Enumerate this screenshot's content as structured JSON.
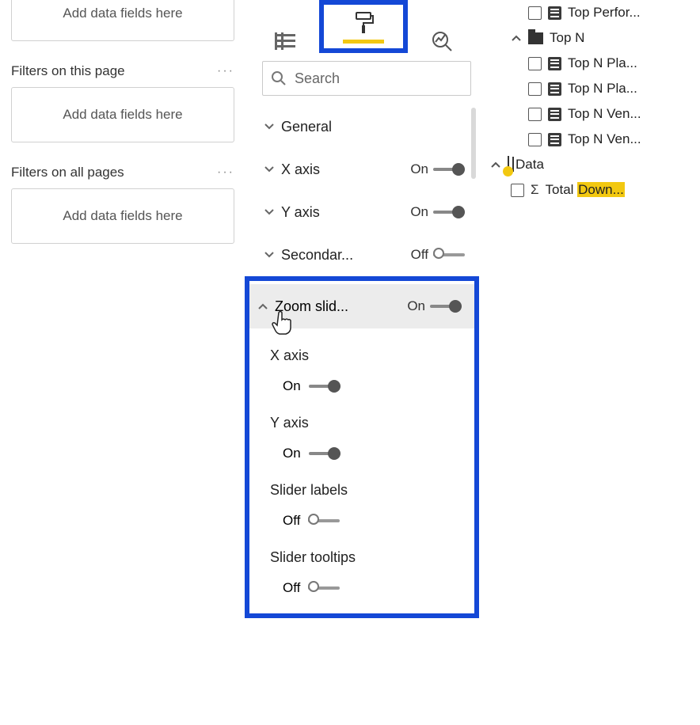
{
  "filters": {
    "dropzone_text": "Add data fields here",
    "page_section": "Filters on this page",
    "all_section": "Filters on all pages"
  },
  "format": {
    "search_placeholder": "Search",
    "sections": {
      "general": "General",
      "x_axis": "X axis",
      "y_axis": "Y axis",
      "secondary": "Secondar...",
      "zoom": "Zoom slid..."
    },
    "toggles": {
      "x_axis": {
        "label": "On",
        "on": true
      },
      "y_axis": {
        "label": "On",
        "on": true
      },
      "secondary": {
        "label": "Off",
        "on": false
      },
      "zoom": {
        "label": "On",
        "on": true
      }
    },
    "zoom_sub": {
      "x_axis_label": "X axis",
      "x_axis_toggle": {
        "label": "On",
        "on": true
      },
      "y_axis_label": "Y axis",
      "y_axis_toggle": {
        "label": "On",
        "on": true
      },
      "slider_labels_label": "Slider labels",
      "slider_labels_toggle": {
        "label": "Off",
        "on": false
      },
      "slider_tooltips_label": "Slider tooltips",
      "slider_tooltips_toggle": {
        "label": "Off",
        "on": false
      }
    }
  },
  "fields": {
    "items": [
      {
        "label": "Top Perfor..."
      },
      {
        "group": "Top N"
      },
      {
        "label": "Top N Pla..."
      },
      {
        "label": "Top N Pla..."
      },
      {
        "label": "Top N Ven..."
      },
      {
        "label": "Top N Ven..."
      }
    ],
    "data_table": "Data",
    "total_prefix": "Total ",
    "total_hl": "Down...",
    "total_full": "Total Down..."
  }
}
